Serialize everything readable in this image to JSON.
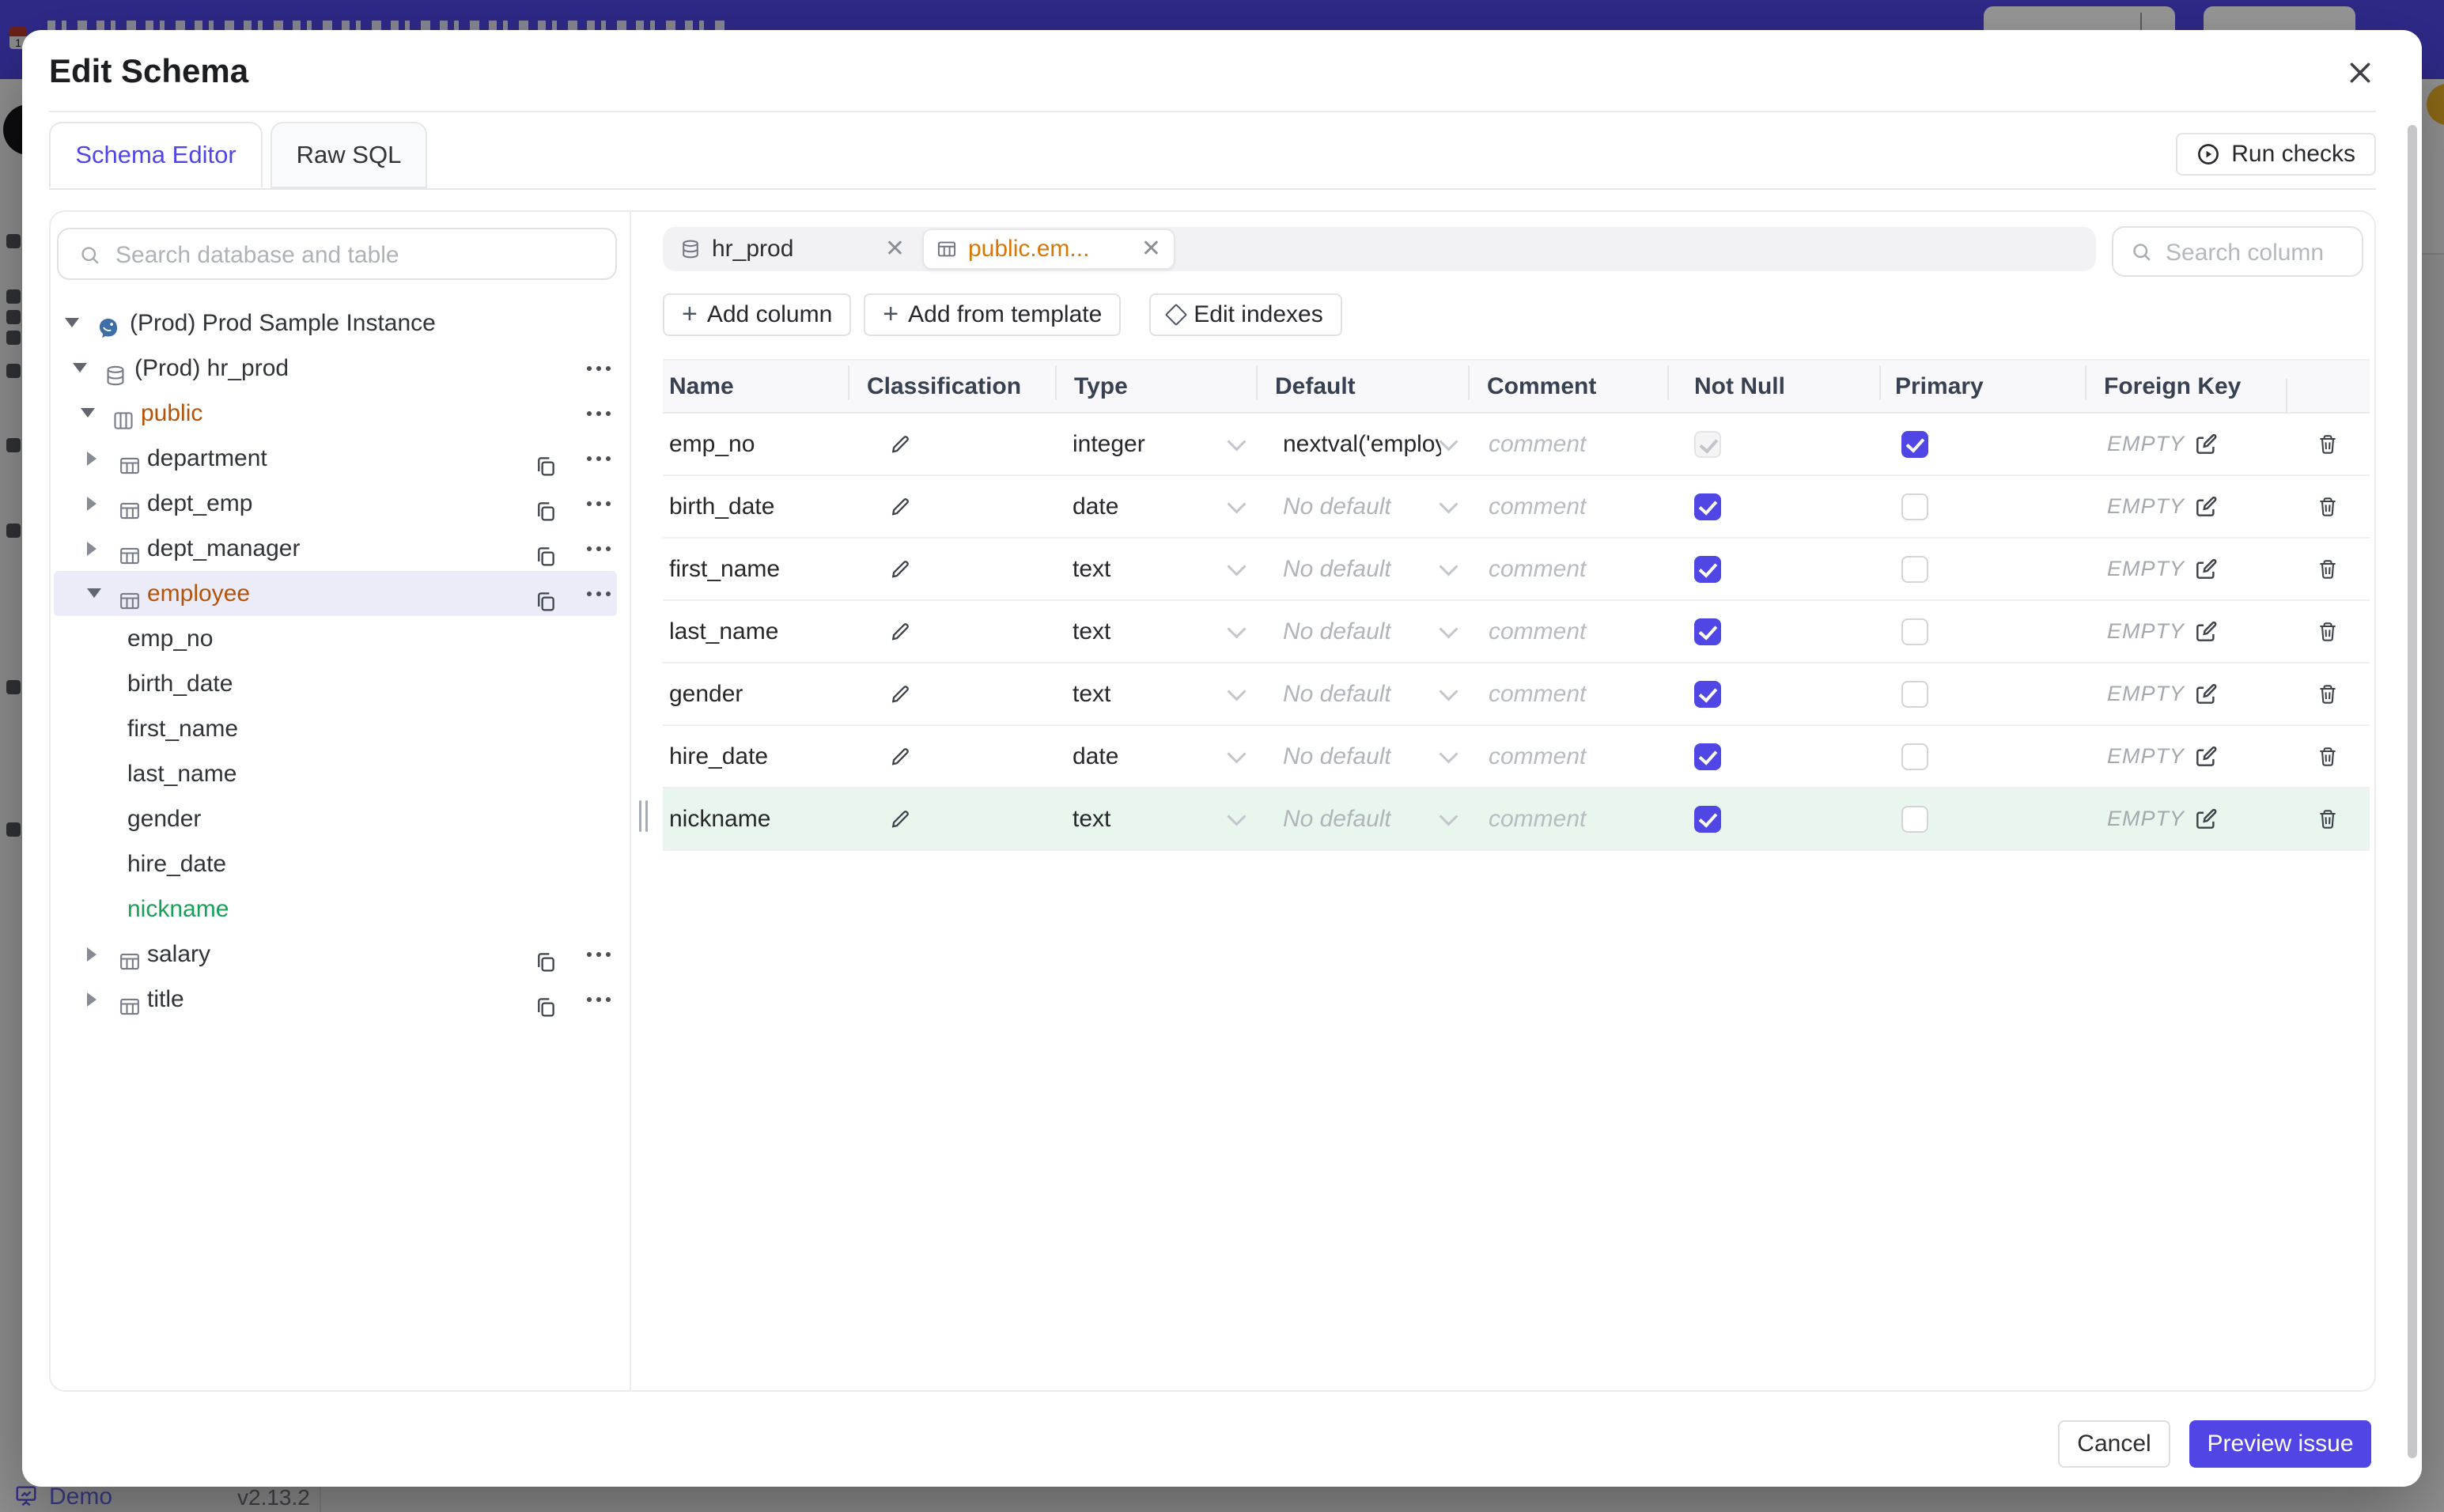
{
  "backdrop": {
    "demo_label": "Demo",
    "version": "v2.13.2"
  },
  "modal": {
    "title": "Edit Schema",
    "tabs": [
      {
        "label": "Schema Editor",
        "active": true
      },
      {
        "label": "Raw SQL",
        "active": false
      }
    ],
    "run_checks_label": "Run checks",
    "sidebar": {
      "search_placeholder": "Search database and table",
      "tree": {
        "instance_label": "(Prod) Prod Sample Instance",
        "database_label": "(Prod) hr_prod",
        "schema_label": "public",
        "tables": [
          "department",
          "dept_emp",
          "dept_manager",
          "employee",
          "salary",
          "title"
        ],
        "selected_table": "employee",
        "employee_columns": [
          "emp_no",
          "birth_date",
          "first_name",
          "last_name",
          "gender",
          "hire_date",
          "nickname"
        ],
        "new_column": "nickname"
      }
    },
    "editor": {
      "chips": [
        {
          "label": "hr_prod",
          "kind": "database",
          "active": false
        },
        {
          "label": "public.em...",
          "kind": "table",
          "active": true
        }
      ],
      "search_column_placeholder": "Search column",
      "toolbar": {
        "add_column": "Add column",
        "add_from_template": "Add from template",
        "edit_indexes": "Edit indexes"
      },
      "table": {
        "headers": [
          "Name",
          "Classification",
          "Type",
          "Default",
          "Comment",
          "Not Null",
          "Primary",
          "Foreign Key"
        ],
        "comment_placeholder": "comment",
        "fk_empty_label": "EMPTY",
        "rows": [
          {
            "name": "emp_no",
            "type": "integer",
            "default": "nextval('employ",
            "has_default": true,
            "not_null": true,
            "not_null_disabled": true,
            "primary": true,
            "is_new": false
          },
          {
            "name": "birth_date",
            "type": "date",
            "default": "No default",
            "has_default": false,
            "not_null": true,
            "not_null_disabled": false,
            "primary": false,
            "is_new": false
          },
          {
            "name": "first_name",
            "type": "text",
            "default": "No default",
            "has_default": false,
            "not_null": true,
            "not_null_disabled": false,
            "primary": false,
            "is_new": false
          },
          {
            "name": "last_name",
            "type": "text",
            "default": "No default",
            "has_default": false,
            "not_null": true,
            "not_null_disabled": false,
            "primary": false,
            "is_new": false
          },
          {
            "name": "gender",
            "type": "text",
            "default": "No default",
            "has_default": false,
            "not_null": true,
            "not_null_disabled": false,
            "primary": false,
            "is_new": false
          },
          {
            "name": "hire_date",
            "type": "date",
            "default": "No default",
            "has_default": false,
            "not_null": true,
            "not_null_disabled": false,
            "primary": false,
            "is_new": false
          },
          {
            "name": "nickname",
            "type": "text",
            "default": "No default",
            "has_default": false,
            "not_null": true,
            "not_null_disabled": false,
            "primary": false,
            "is_new": true
          }
        ]
      }
    },
    "footer": {
      "cancel_label": "Cancel",
      "preview_label": "Preview issue"
    }
  }
}
